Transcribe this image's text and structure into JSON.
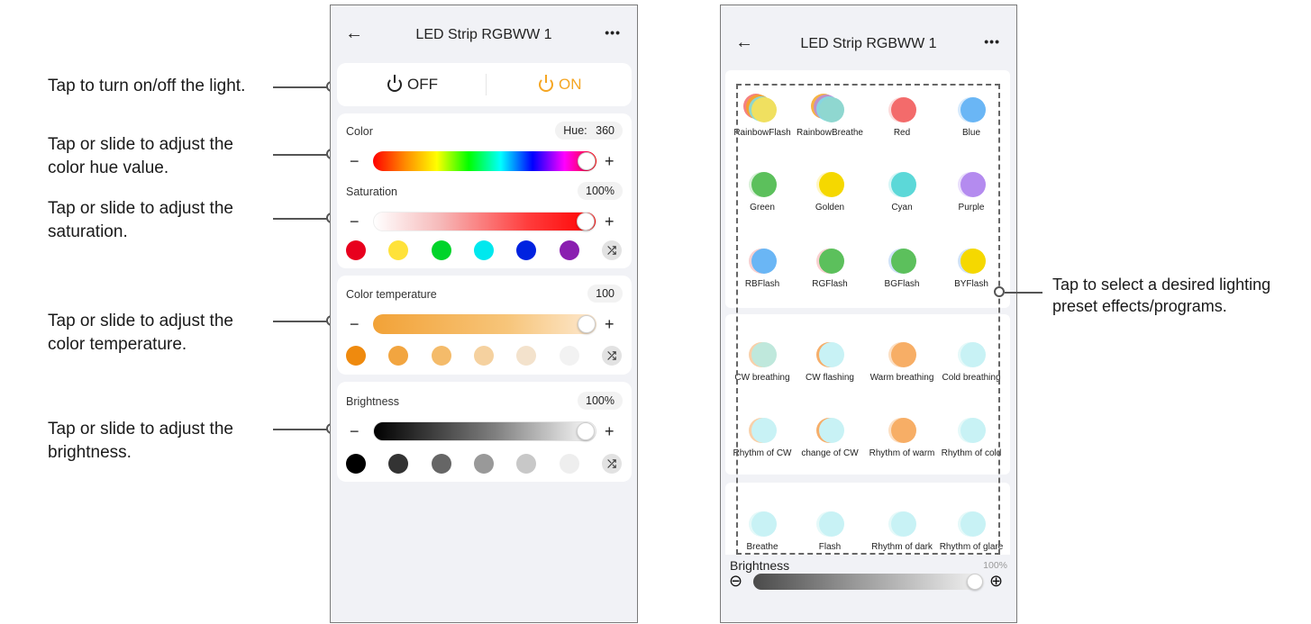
{
  "annotations": {
    "power": "Tap to turn on/off the light.",
    "hue_1": "Tap or slide to adjust the",
    "hue_2": "color hue value.",
    "sat_1": "Tap or slide to adjust the",
    "sat_2": "saturation.",
    "temp_1": "Tap or slide to adjust the",
    "temp_2": "color temperature.",
    "bright_1": "Tap or slide to adjust the",
    "bright_2": "brightness.",
    "effects_1": "Tap to select a desired lighting",
    "effects_2": "preset effects/programs."
  },
  "left_screen": {
    "title": "LED Strip RGBWW 1",
    "back_icon": "arrow-left-icon",
    "more_icon": "more-dots-icon",
    "more_glyph": "•••",
    "power": {
      "off_label": "OFF",
      "on_label": "ON",
      "power_icon": "power-icon",
      "on_color": "#f5a623",
      "off_color": "#222222"
    },
    "color": {
      "label": "Color",
      "hue_label": "Hue:",
      "hue_value": "360",
      "level": 1.0
    },
    "saturation": {
      "label": "Saturation",
      "value": "100%",
      "level": 1.0,
      "swatches": [
        "#e8001d",
        "#ffe23a",
        "#00d42a",
        "#00e8ee",
        "#0022e0",
        "#8a1fb0"
      ]
    },
    "temperature": {
      "label": "Color temperature",
      "value": "100",
      "level": 1.0,
      "swatches": [
        "#ef8a0e",
        "#f2a540",
        "#f4bb6a",
        "#f5d19f",
        "#f3e2cc",
        "#f2f2f2"
      ]
    },
    "brightness": {
      "label": "Brightness",
      "value": "100%",
      "level": 1.0,
      "swatches": [
        "#000000",
        "#333333",
        "#666666",
        "#999999",
        "#c8c8c8",
        "#eeeeee"
      ]
    },
    "minus": "−",
    "plus": "+",
    "shuffle_icon": "shuffle-icon",
    "shuffle_glyph": "⤮"
  },
  "right_screen": {
    "title": "LED Strip RGBWW 1",
    "more_glyph": "•••",
    "groups": [
      [
        {
          "label": "RainbowFlash",
          "colors": [
            "#f36b6b",
            "#f5a623",
            "#7ee0e6",
            "#f0e060"
          ]
        },
        {
          "label": "RainbowBreathe",
          "colors": [
            "#f5a623",
            "#b48be0",
            "#7ee0e6",
            "#8fd7d0"
          ]
        },
        {
          "label": "Red",
          "colors": [
            "#fcd6d6",
            "#f36b6b"
          ]
        },
        {
          "label": "Blue",
          "colors": [
            "#cfe6fb",
            "#6ab6f5"
          ]
        },
        {
          "label": "Green",
          "colors": [
            "#d2efd2",
            "#5cc05c"
          ]
        },
        {
          "label": "Golden",
          "colors": [
            "#fff4b8",
            "#f5d800"
          ]
        },
        {
          "label": "Cyan",
          "colors": [
            "#cff5f5",
            "#5cd8d8"
          ]
        },
        {
          "label": "Purple",
          "colors": [
            "#e6d9fb",
            "#b48bef"
          ]
        },
        {
          "label": "RBFlash",
          "colors": [
            "#f8c8c8",
            "#6ab6f5"
          ]
        },
        {
          "label": "RGFlash",
          "colors": [
            "#f8c8c8",
            "#5cc05c"
          ]
        },
        {
          "label": "BGFlash",
          "colors": [
            "#c8ddf8",
            "#5cc05c"
          ]
        },
        {
          "label": "BYFlash",
          "colors": [
            "#c8ddf8",
            "#f5d800"
          ]
        }
      ],
      [
        {
          "label": "CW breathing",
          "colors": [
            "#f8c89a",
            "#bfe8dc"
          ]
        },
        {
          "label": "CW flashing",
          "colors": [
            "#f5a050",
            "#c8f2f5"
          ]
        },
        {
          "label": "Warm breathing",
          "colors": [
            "#fbd9b8",
            "#f7ae66"
          ]
        },
        {
          "label": "Cold breathing",
          "colors": [
            "#e0f8f8",
            "#c8f2f5"
          ]
        },
        {
          "label": "Rhythm of CW",
          "colors": [
            "#f8c89a",
            "#c8f2f5"
          ]
        },
        {
          "label": "change of CW",
          "colors": [
            "#f5a050",
            "#c8f2f5"
          ]
        },
        {
          "label": "Rhythm of warm",
          "colors": [
            "#fbd9b8",
            "#f7ae66"
          ]
        },
        {
          "label": "Rhythm of cold",
          "colors": [
            "#e0f8f8",
            "#c8f2f5"
          ]
        }
      ],
      [
        {
          "label": "Breathe",
          "colors": [
            "#e0f8f8",
            "#c8f2f5"
          ]
        },
        {
          "label": "Flash",
          "colors": [
            "#e0f8f8",
            "#c8f2f5"
          ]
        },
        {
          "label": "Rhythm of dark",
          "colors": [
            "#e0f8f8",
            "#c8f2f5"
          ]
        },
        {
          "label": "Rhythm of glare",
          "colors": [
            "#e0f8f8",
            "#c8f2f5"
          ]
        }
      ]
    ],
    "brightness": {
      "label": "Brightness",
      "value": "100%",
      "level": 1.0,
      "minus_glyph": "⊖",
      "plus_glyph": "⊕"
    }
  }
}
